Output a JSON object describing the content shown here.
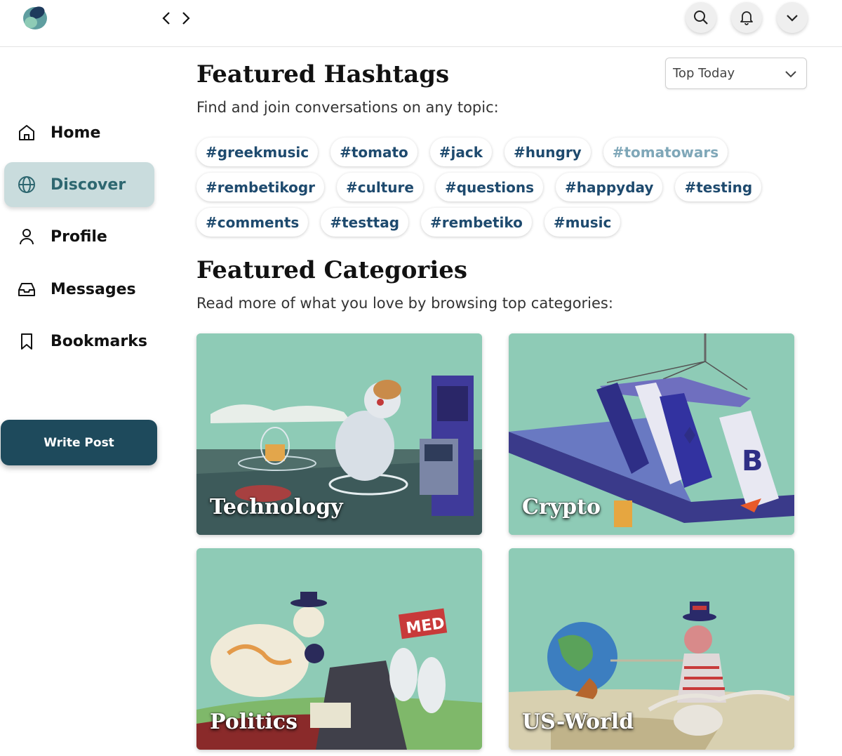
{
  "nav": {
    "back_glyph": "<",
    "forward_glyph": ">"
  },
  "topbar": {
    "icons": [
      "search-icon",
      "bell-icon",
      "chevron-down-icon"
    ]
  },
  "sidebar": {
    "items": [
      {
        "label": "Home",
        "icon": "home-icon",
        "active": false
      },
      {
        "label": "Discover",
        "icon": "globe-icon",
        "active": true
      },
      {
        "label": "Profile",
        "icon": "user-icon",
        "active": false
      },
      {
        "label": "Messages",
        "icon": "inbox-icon",
        "active": false
      },
      {
        "label": "Bookmarks",
        "icon": "bookmark-icon",
        "active": false
      }
    ],
    "write_post_label": "Write Post"
  },
  "hashtags": {
    "title": "Featured Hashtags",
    "subtitle": "Find and join conversations on any topic:",
    "filter": "Top Today",
    "rows": [
      [
        "#greekmusic",
        "#tomato",
        "#jack",
        "#hungry",
        "#tomatowars"
      ],
      [
        "#rembetikogr",
        "#culture",
        "#questions",
        "#happyday",
        "#testing"
      ],
      [
        "#comments",
        "#testtag",
        "#rembetiko",
        "#music"
      ]
    ]
  },
  "categories": {
    "title": "Featured Categories",
    "subtitle": "Read more of what you love by browsing top categories:",
    "cards": [
      {
        "label": "Technology"
      },
      {
        "label": "Crypto"
      },
      {
        "label": "Politics"
      },
      {
        "label": "US-World"
      }
    ]
  },
  "colors": {
    "accent": "#1e4a5c",
    "active_bg": "#c9dcdd",
    "card_bg": "#8ecbb6",
    "tag_text": "#1e4a6e"
  }
}
